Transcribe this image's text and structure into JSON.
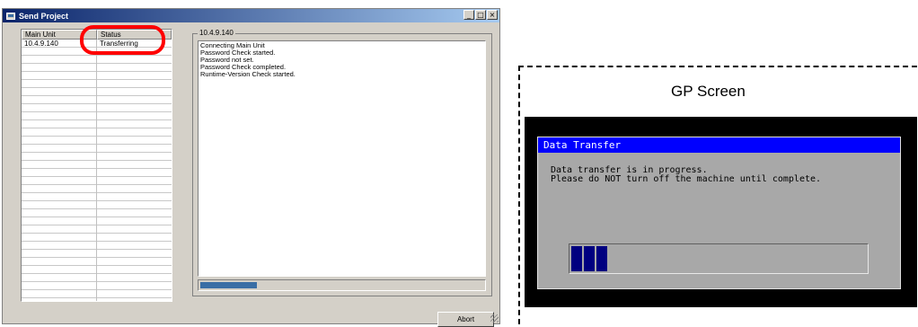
{
  "window": {
    "title": "Send Project",
    "minimize": "_",
    "maximize": "□",
    "close": "×"
  },
  "unit_list": {
    "columns": [
      "Main Unit",
      "Status"
    ],
    "rows": [
      {
        "unit": "10.4.9.140",
        "status": "Transferring"
      }
    ]
  },
  "log_panel": {
    "label": "10.4.9.140",
    "lines": [
      "Connecting Main Unit",
      "Password Check started.",
      "Password not set.",
      "Password Check completed.",
      "Runtime-Version Check started."
    ],
    "progress": 0.2
  },
  "abort_label": "Abort",
  "gp": {
    "label": "GP Screen",
    "dialog_title": "Data Transfer",
    "message": [
      "Data transfer is in progress.",
      "Please do NOT turn off the machine until complete."
    ],
    "progress_blocks": 3
  },
  "colors": {
    "title_bar": "#0a246a",
    "highlight": "#ff0000",
    "gp_title_bar": "#0000ff",
    "gp_block": "#000080"
  }
}
